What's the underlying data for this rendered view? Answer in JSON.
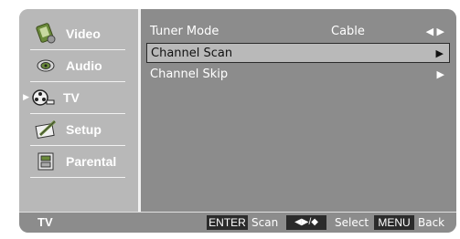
{
  "sidebar": {
    "items": [
      {
        "label": "Video",
        "icon": "film-reel-icon"
      },
      {
        "label": "Audio",
        "icon": "speaker-icon"
      },
      {
        "label": "TV",
        "icon": "tv-reel-icon",
        "active": true
      },
      {
        "label": "Setup",
        "icon": "pen-note-icon"
      },
      {
        "label": "Parental",
        "icon": "lock-box-icon"
      }
    ],
    "active_marker": "▶"
  },
  "panel": {
    "rows": [
      {
        "label": "Tuner Mode",
        "value": "Cable",
        "arrow": "◀ ▶"
      },
      {
        "label": "Channel Scan",
        "value": "",
        "arrow": "▶",
        "selected": true
      },
      {
        "label": "Channel Skip",
        "value": "",
        "arrow": "▶"
      }
    ]
  },
  "bottombar": {
    "title": "TV",
    "enter_key": "ENTER",
    "enter_hint": "Scan",
    "nav_key": "◀▶/◆",
    "nav_hint": "Select",
    "menu_key": "MENU",
    "menu_hint": "Back"
  },
  "colors": {
    "frame": "#b8b8b8",
    "panel": "#8c8c8c",
    "selected_row": "#b9b9b9",
    "key_bg": "#2b2b2b"
  }
}
